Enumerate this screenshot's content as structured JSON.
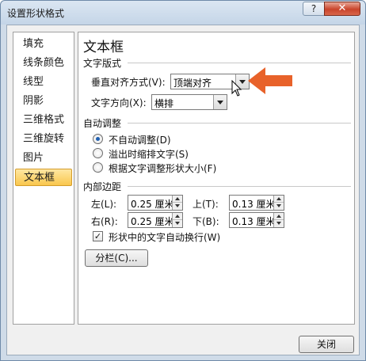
{
  "window": {
    "title": "设置形状格式",
    "help_label": "?",
    "close_glyph": "✕"
  },
  "nav": {
    "items": [
      {
        "label": "填充"
      },
      {
        "label": "线条颜色"
      },
      {
        "label": "线型"
      },
      {
        "label": "阴影"
      },
      {
        "label": "三维格式"
      },
      {
        "label": "三维旋转"
      },
      {
        "label": "图片"
      },
      {
        "label": "文本框",
        "selected": true
      }
    ]
  },
  "panel": {
    "title": "文本框",
    "text_layout": {
      "heading": "文字版式",
      "vertical_align_label": "垂直对齐方式(V):",
      "vertical_align_value": "顶端对齐",
      "text_direction_label": "文字方向(X):",
      "text_direction_value": "横排"
    },
    "autofit": {
      "heading": "自动调整",
      "options": [
        {
          "label": "不自动调整(D)",
          "checked": true
        },
        {
          "label": "溢出时缩排文字(S)",
          "checked": false
        },
        {
          "label": "根据文字调整形状大小(F)",
          "checked": false
        }
      ]
    },
    "margins": {
      "heading": "内部边距",
      "left_label": "左(L):",
      "left_value": "0.25 厘米",
      "top_label": "上(T):",
      "top_value": "0.13 厘米",
      "right_label": "右(R):",
      "right_value": "0.25 厘米",
      "bottom_label": "下(B):",
      "bottom_value": "0.13 厘米",
      "wrap_label": "形状中的文字自动换行(W)",
      "wrap_checked": true,
      "columns_button": "分栏(C)..."
    }
  },
  "footer": {
    "close_button": "关闭"
  },
  "colors": {
    "annotation_arrow": "#e8622a",
    "selected_nav": "#f9c74d"
  },
  "icons": {
    "check": "✓"
  }
}
